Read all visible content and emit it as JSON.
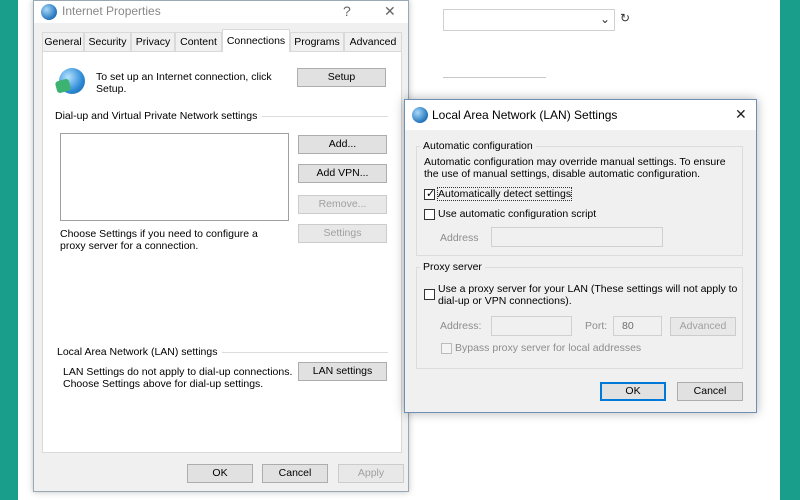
{
  "internet_properties": {
    "title": "Internet Properties",
    "help_glyph": "?",
    "close_glyph": "✕",
    "tabs": [
      "General",
      "Security",
      "Privacy",
      "Content",
      "Connections",
      "Programs",
      "Advanced"
    ],
    "setup_text": "To set up an Internet connection, click Setup.",
    "setup_button": "Setup",
    "dialup_section": "Dial-up and Virtual Private Network settings",
    "add_button": "Add...",
    "add_vpn_button": "Add VPN...",
    "remove_button": "Remove...",
    "settings_text": "Choose Settings if you need to configure a proxy server for a connection.",
    "settings_button": "Settings",
    "lan_section": "Local Area Network (LAN) settings",
    "lan_text": "LAN Settings do not apply to dial-up connections. Choose Settings above for dial-up settings.",
    "lan_settings_button": "LAN settings",
    "ok_button": "OK",
    "cancel_button": "Cancel",
    "apply_button": "Apply"
  },
  "lan_dialog": {
    "title": "Local Area Network (LAN) Settings",
    "close_glyph": "✕",
    "auto_config_group": "Automatic configuration",
    "auto_config_desc": "Automatic configuration may override manual settings.  To ensure the use of manual settings, disable automatic configuration.",
    "auto_detect_label": "Automatically detect settings",
    "auto_detect_checked": true,
    "use_script_label": "Use automatic configuration script",
    "use_script_checked": false,
    "address_label": "Address",
    "address_value": "",
    "proxy_group": "Proxy server",
    "use_proxy_label": "Use a proxy server for your LAN (These settings will not apply to dial-up or VPN connections).",
    "use_proxy_checked": false,
    "proxy_address_label": "Address:",
    "proxy_address_value": "",
    "port_label": "Port:",
    "port_value": "80",
    "advanced_button": "Advanced",
    "bypass_label": "Bypass proxy server for local addresses",
    "bypass_checked": false,
    "ok_button": "OK",
    "cancel_button": "Cancel"
  },
  "background": {
    "chevron_glyph": "⌄",
    "refresh_glyph": "↻"
  },
  "icons": {
    "window_icon": "internet-options-globe",
    "setup_icon": "network-globe"
  }
}
